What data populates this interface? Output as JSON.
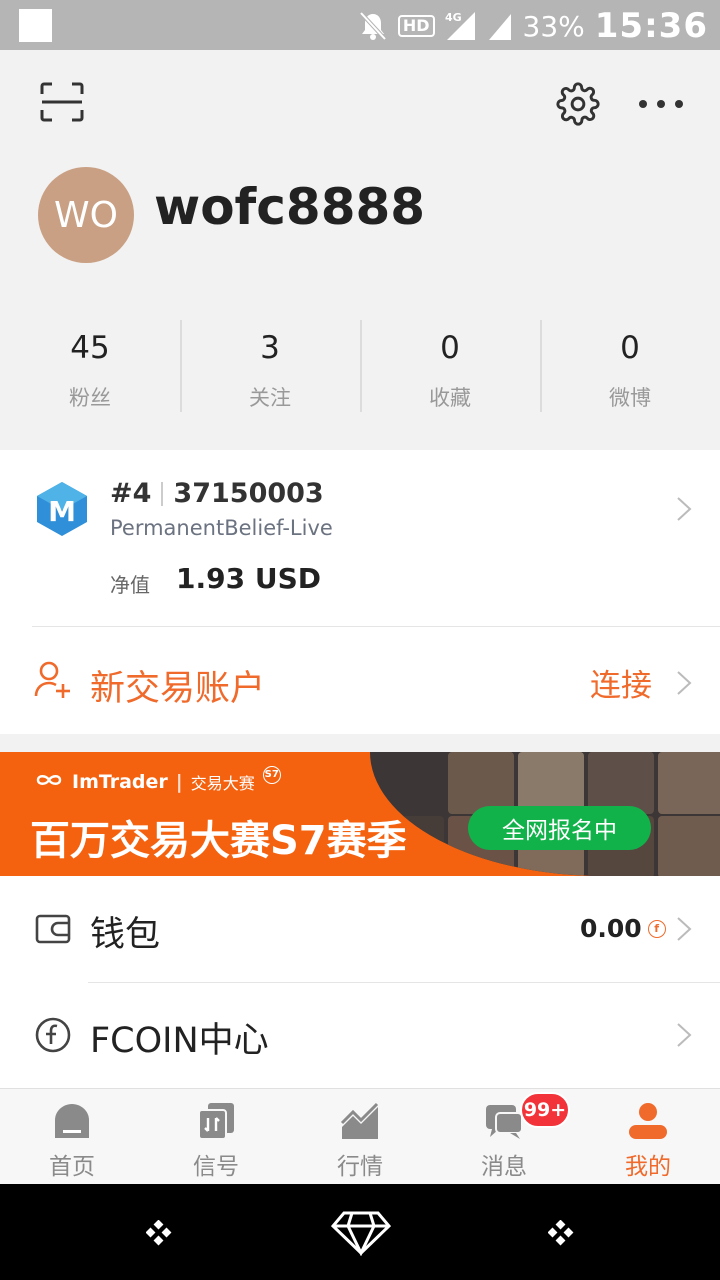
{
  "status_bar": {
    "battery": "33%",
    "time": "15:36",
    "network": "4G",
    "hd": "HD"
  },
  "profile": {
    "avatar_initials": "WO",
    "username": "wofc8888"
  },
  "stats": [
    {
      "value": "45",
      "label": "粉丝"
    },
    {
      "value": "3",
      "label": "关注"
    },
    {
      "value": "0",
      "label": "收藏"
    },
    {
      "value": "0",
      "label": "微博"
    }
  ],
  "account": {
    "rank": "#4",
    "number": "37150003",
    "server": "PermanentBelief-Live",
    "net_value_label": "净值",
    "net_value": "1.93 USD"
  },
  "new_account": {
    "label": "新交易账户",
    "action": "连接"
  },
  "banner": {
    "brand": "ImTrader",
    "subtitle": "交易大赛",
    "badge": "S7",
    "title": "百万交易大赛S7赛季",
    "cta": "全网报名中"
  },
  "menu": [
    {
      "label": "钱包",
      "value": "0.00",
      "icon": "wallet-icon"
    },
    {
      "label": "FCOIN中心",
      "value": "",
      "icon": "fcoin-icon"
    }
  ],
  "tabs": [
    {
      "label": "首页",
      "icon": "home-icon",
      "active": false
    },
    {
      "label": "信号",
      "icon": "signal-icon",
      "active": false
    },
    {
      "label": "行情",
      "icon": "market-icon",
      "active": false
    },
    {
      "label": "消息",
      "icon": "message-icon",
      "active": false
    },
    {
      "label": "我的",
      "icon": "profile-icon",
      "active": true
    }
  ],
  "message_badge": "99+",
  "colors": {
    "accent": "#f06a2b",
    "banner": "#f5620f",
    "cta": "#12b24a",
    "badge": "#f2333a"
  }
}
